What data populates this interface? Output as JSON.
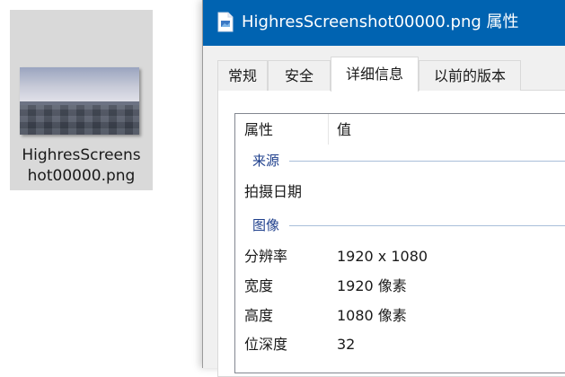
{
  "desktop": {
    "file_name_line1": "HighresScreens",
    "file_name_line2": "hot00000.png"
  },
  "dialog": {
    "title": "HighresScreenshot00000.png 属性",
    "title_bar_color": "#0063b1",
    "tabs": [
      {
        "label": "常规",
        "active": false
      },
      {
        "label": "安全",
        "active": false
      },
      {
        "label": "详细信息",
        "active": true
      },
      {
        "label": "以前的版本",
        "active": false
      }
    ],
    "columns": {
      "property": "属性",
      "value": "值"
    },
    "groups": [
      {
        "label": "来源",
        "rows": [
          {
            "name": "拍摄日期",
            "value": ""
          }
        ]
      },
      {
        "label": "图像",
        "rows": [
          {
            "name": "分辨率",
            "value": "1920 x 1080"
          },
          {
            "name": "宽度",
            "value": "1920 像素"
          },
          {
            "name": "高度",
            "value": "1080 像素"
          },
          {
            "name": "位深度",
            "value": "32"
          }
        ]
      }
    ],
    "group_label_color": "#1e3f8c"
  }
}
